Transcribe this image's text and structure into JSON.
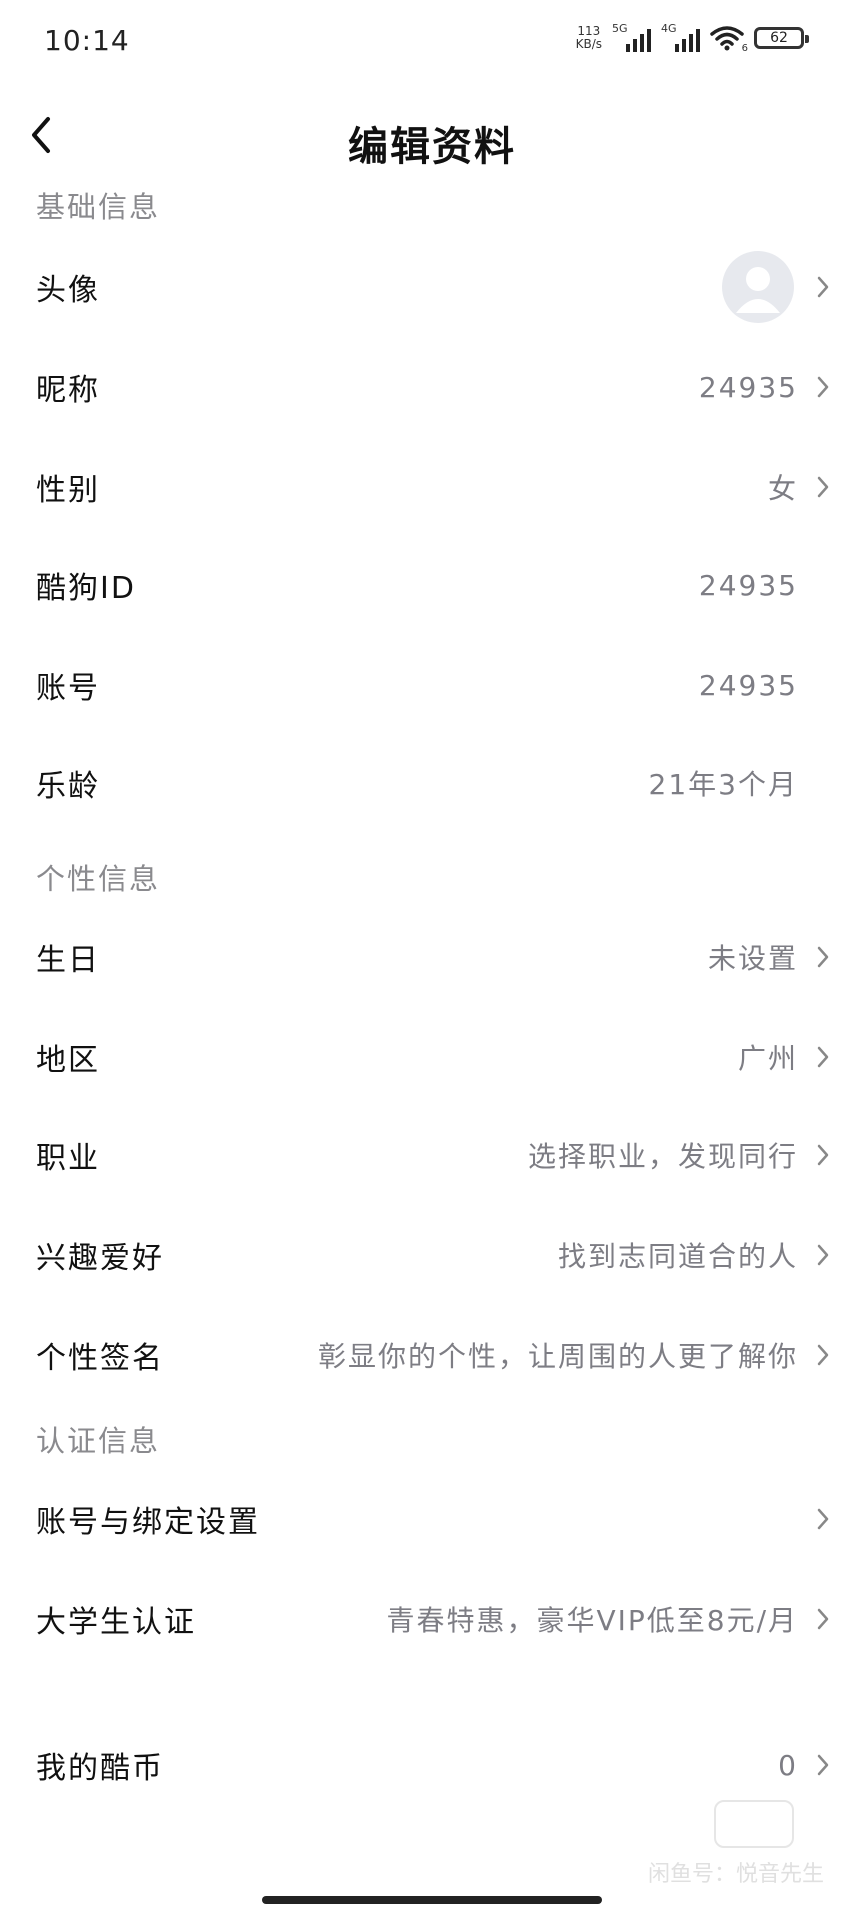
{
  "status_bar": {
    "time": "10:14",
    "net_speed_value": "113",
    "net_speed_unit": "KB/s",
    "signal1_tag": "5G",
    "signal2_tag": "4G",
    "wifi_sub": "6",
    "battery": "62"
  },
  "header": {
    "title": "编辑资料"
  },
  "sections": {
    "basic": "基础信息",
    "personal": "个性信息",
    "auth": "认证信息"
  },
  "rows": {
    "avatar": {
      "label": "头像"
    },
    "nickname": {
      "label": "昵称",
      "value": "24935"
    },
    "gender": {
      "label": "性别",
      "value": "女"
    },
    "kugou_id": {
      "label": "酷狗ID",
      "value": "24935"
    },
    "account": {
      "label": "账号",
      "value": "24935"
    },
    "music_age": {
      "label": "乐龄",
      "value": "21年3个月"
    },
    "birthday": {
      "label": "生日",
      "value": "未设置"
    },
    "region": {
      "label": "地区",
      "value": "广州"
    },
    "occupation": {
      "label": "职业",
      "value": "选择职业，发现同行"
    },
    "hobbies": {
      "label": "兴趣爱好",
      "value": "找到志同道合的人"
    },
    "signature": {
      "label": "个性签名",
      "value": "彰显你的个性，让周围的人更了解你"
    },
    "binding": {
      "label": "账号与绑定设置"
    },
    "student": {
      "label": "大学生认证",
      "value": "青春特惠，豪华VIP低至8元/月"
    },
    "coins": {
      "label": "我的酷币",
      "value": "0"
    }
  },
  "watermark": {
    "text": "闲鱼号：悦音先生"
  },
  "icons": [
    "back-arrow-icon",
    "chevron-right-icon",
    "avatar-placeholder-icon",
    "wifi-icon",
    "signal-icon",
    "battery-icon"
  ]
}
